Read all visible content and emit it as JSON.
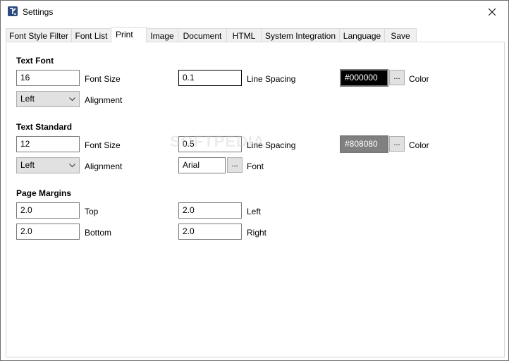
{
  "window": {
    "title": "Settings"
  },
  "tabs": [
    {
      "label": "Font Style Filter"
    },
    {
      "label": "Font List"
    },
    {
      "label": "Print"
    },
    {
      "label": "Image"
    },
    {
      "label": "Document"
    },
    {
      "label": "HTML"
    },
    {
      "label": "System Integration"
    },
    {
      "label": "Language"
    },
    {
      "label": "Save"
    }
  ],
  "text_font": {
    "heading": "Text Font",
    "font_size": {
      "value": "16",
      "label": "Font Size"
    },
    "line_spacing": {
      "value": "0.1",
      "label": "Line Spacing"
    },
    "color": {
      "value": "#000000",
      "label": "Color",
      "swatch": "#000000",
      "text_color": "#ffffff",
      "button": "..."
    },
    "alignment": {
      "value": "Left",
      "label": "Alignment"
    }
  },
  "text_standard": {
    "heading": "Text Standard",
    "font_size": {
      "value": "12",
      "label": "Font Size"
    },
    "line_spacing": {
      "value": "0.5",
      "label": "Line Spacing"
    },
    "color": {
      "value": "#808080",
      "label": "Color",
      "swatch": "#808080",
      "text_color": "#ffffff",
      "button": "..."
    },
    "alignment": {
      "value": "Left",
      "label": "Alignment"
    },
    "font": {
      "value": "Arial",
      "label": "Font",
      "button": "..."
    }
  },
  "page_margins": {
    "heading": "Page Margins",
    "top": {
      "value": "2.0",
      "label": "Top"
    },
    "left": {
      "value": "2.0",
      "label": "Left"
    },
    "bottom": {
      "value": "2.0",
      "label": "Bottom"
    },
    "right": {
      "value": "2.0",
      "label": "Right"
    }
  },
  "watermark": "SOFTPEDIA"
}
